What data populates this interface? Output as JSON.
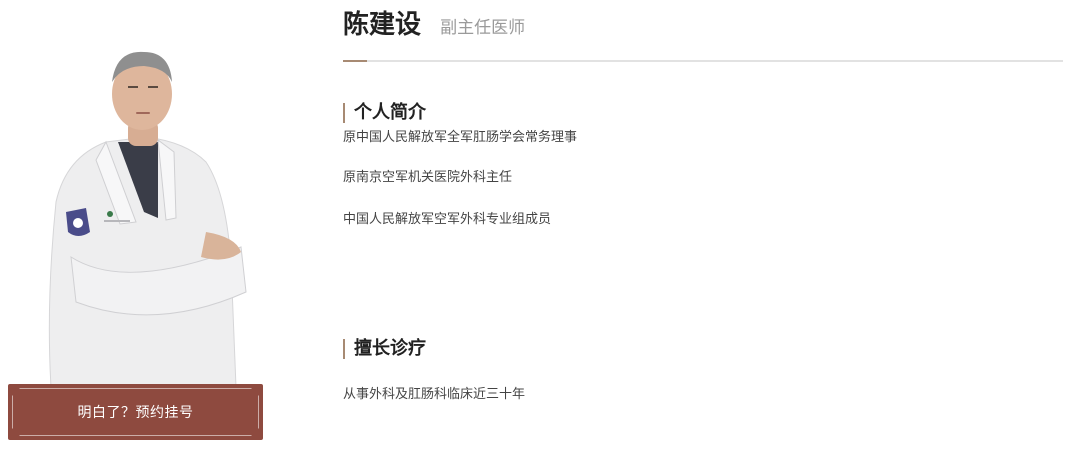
{
  "doctor": {
    "name": "陈建设",
    "title": "副主任医师"
  },
  "appointment": {
    "button_label": "明白了？预约挂号"
  },
  "profile": {
    "heading": "个人简介",
    "items": [
      "原中国人民解放军全军肛肠学会常务理事",
      "原南京空军机关医院外科主任",
      "中国人民解放军空军外科专业组成员"
    ]
  },
  "specialty": {
    "heading": "擅长诊疗",
    "items": [
      "从事外科及肛肠科临床近三十年"
    ]
  },
  "colors": {
    "accent": "#a78a73",
    "button_bg": "#8e4a3f"
  }
}
